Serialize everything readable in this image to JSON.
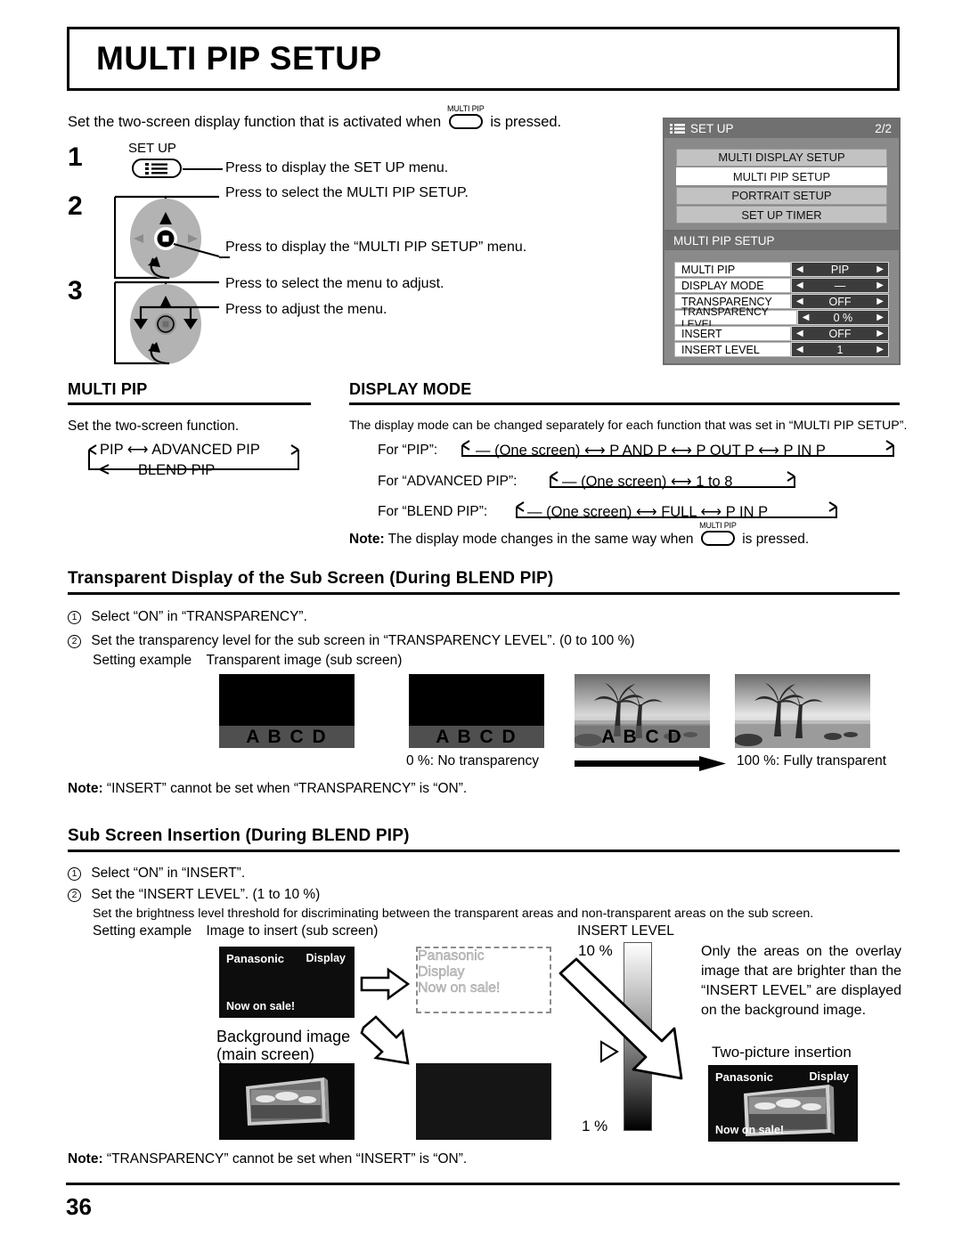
{
  "page": {
    "title": "MULTI PIP SETUP",
    "number": "36",
    "intro_before": "Set the two-screen display function that is activated when",
    "intro_after": "is pressed.",
    "multi_pip_button_label": "MULTI PIP"
  },
  "steps": [
    {
      "number": "1",
      "button_label": "SET UP",
      "button_icon": "list-icon",
      "lines": [
        "Press to display the SET UP menu."
      ]
    },
    {
      "number": "2",
      "button_icon": "joystick-updown-enter",
      "lines": [
        "Press to select the MULTI PIP SETUP.",
        "Press to display the “MULTI PIP SETUP” menu."
      ]
    },
    {
      "number": "3",
      "button_icon": "joystick-updown-leftright",
      "lines": [
        "Press to select the menu to adjust.",
        "Press to adjust the menu."
      ]
    }
  ],
  "osd_setup": {
    "header_title": "SET UP",
    "header_icon": "list-icon",
    "page_indicator": "2/2",
    "items": [
      {
        "label": "MULTI DISPLAY SETUP",
        "selected": false
      },
      {
        "label": "MULTI PIP SETUP",
        "selected": true
      },
      {
        "label": "PORTRAIT SETUP",
        "selected": false
      },
      {
        "label": "SET UP TIMER",
        "selected": false
      }
    ]
  },
  "osd_multipip": {
    "header_title": "MULTI PIP SETUP",
    "rows": [
      {
        "name": "MULTI PIP",
        "value": "PIP"
      },
      {
        "name": "DISPLAY MODE",
        "value": "—"
      },
      {
        "name": "TRANSPARENCY",
        "value": "OFF"
      },
      {
        "name": "TRANSPARENCY LEVEL",
        "value": "0 %"
      },
      {
        "name": "INSERT",
        "value": "OFF"
      },
      {
        "name": "INSERT LEVEL",
        "value": "1"
      }
    ],
    "left_arrow": "◀",
    "right_arrow": "▶"
  },
  "multi_pip_section": {
    "heading": "MULTI PIP",
    "description": "Set the two-screen function.",
    "cycle_row1": "PIP ⟷ ADVANCED PIP",
    "cycle_row2": "BLEND PIP",
    "cycle_items": [
      "PIP",
      "ADVANCED PIP",
      "BLEND PIP"
    ]
  },
  "display_mode_section": {
    "heading": "DISPLAY MODE",
    "description": "The display mode can be changed separately for each function that was set in “MULTI PIP SETUP”.",
    "rows": [
      {
        "label": "For “PIP”:",
        "chain": "— (One screen) ⟷ P AND P ⟷ P OUT P ⟷ P IN P"
      },
      {
        "label": "For “ADVANCED PIP”:",
        "chain": "— (One screen) ⟷ 1 to 8"
      },
      {
        "label": "For “BLEND PIP”:",
        "chain": "— (One screen) ⟷ FULL ⟷ P IN P"
      }
    ],
    "note_label": "Note:",
    "note_before": "The display mode changes in the same way when",
    "note_after": "is pressed."
  },
  "transparent_section": {
    "heading": "Transparent Display of the Sub Screen (During BLEND PIP)",
    "step1": "Select “ON” in “TRANSPARENCY”.",
    "step2": "Set the transparency level for the sub screen in “TRANSPARENCY LEVEL”. (0 to 100 %)",
    "setting_example_label": "Setting example",
    "setting_example_value": "Transparent image (sub screen)",
    "abcd": "A B C D",
    "caption_left": "0 %: No transparency",
    "caption_right": "100 %: Fully transparent",
    "note_label": "Note:",
    "note_text": "“INSERT” cannot be set when “TRANSPARENCY” is “ON”."
  },
  "insert_section": {
    "heading": "Sub Screen Insertion (During BLEND PIP)",
    "step1": "Select “ON” in “INSERT”.",
    "step2": "Set the “INSERT LEVEL”. (1 to 10 %)",
    "step2_detail": "Set the brightness level threshold for discriminating between the transparent areas and non-transparent areas on the sub screen.",
    "setting_example_label": "Setting example",
    "setting_example_value": "Image to insert (sub screen)",
    "background_caption_line1": "Background image",
    "background_caption_line2": "(main screen)",
    "insert_level_label": "INSERT LEVEL",
    "scale_top": "10 %",
    "scale_bottom": "1 %",
    "explanation": "Only the areas on the overlay image that are brighter than the “INSERT LEVEL” are displayed on the background image.",
    "two_picture_label": "Two-picture insertion",
    "sample_screen": {
      "brand": "Panasonic",
      "display": "Display",
      "sale": "Now on sale!"
    },
    "note_label": "Note:",
    "note_text": "“TRANSPARENCY” cannot be set when “INSERT” is “ON”."
  }
}
